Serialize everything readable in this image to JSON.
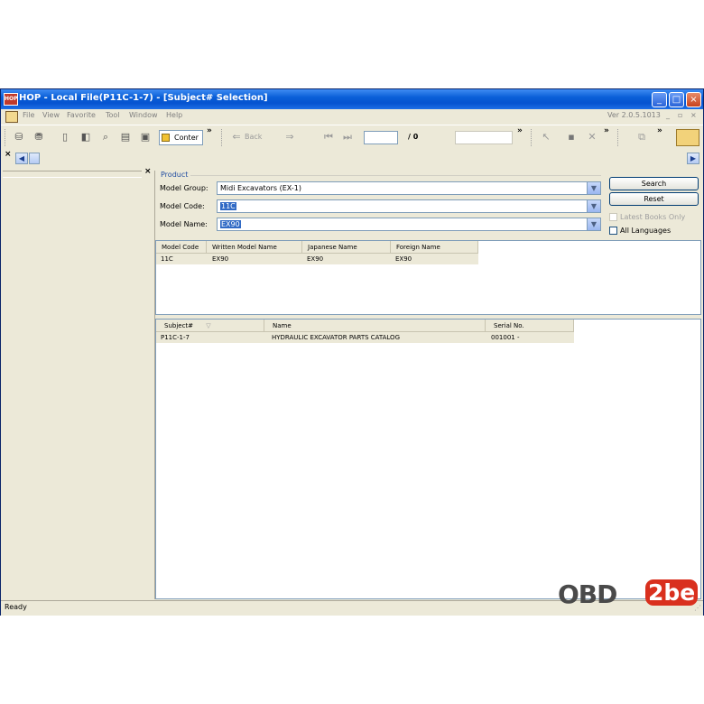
{
  "window": {
    "app_icon": "HOP",
    "title": "HOP - Local File(P11C-1-7) - [Subject# Selection]",
    "minimize": "_",
    "maximize": "□",
    "close": "×"
  },
  "menubar": {
    "items": [
      "File",
      "View",
      "Favorite",
      "Tool",
      "Window",
      "Help"
    ],
    "version": "Ver 2.0.5.1013"
  },
  "toolbar": {
    "contents_label": "Conter",
    "back_label": "Back",
    "page_value": "",
    "page_total": "/ 0",
    "chevron": "»"
  },
  "left_panel": {
    "close": "×"
  },
  "product": {
    "heading": "Product",
    "model_group_label": "Model Group:",
    "model_group_value": "Midi Excavators (EX-1)",
    "model_code_label": "Model Code:",
    "model_code_value": "11C",
    "model_name_label": "Model Name:",
    "model_name_value": "EX90",
    "search_label": "Search",
    "reset_label": "Reset",
    "latest_books_label": "Latest Books Only",
    "all_languages_label": "All Languages"
  },
  "model_table": {
    "headers": [
      "Model Code",
      "Written Model Name",
      "Japanese Name",
      "Foreign Name"
    ],
    "rows": [
      [
        "11C",
        "EX90",
        "EX90",
        "EX90"
      ]
    ]
  },
  "subject_table": {
    "headers": [
      "Subject#",
      "Name",
      "Serial No."
    ],
    "rows": [
      [
        "P11C-1-7",
        "HYDRAULIC EXCAVATOR PARTS CATALOG",
        "001001 -"
      ]
    ]
  },
  "status": {
    "text": "Ready"
  },
  "watermark": {
    "text_left": "OBD",
    "text_right": "2be"
  },
  "colors": {
    "titlebar": "#0a5fd8",
    "selection": "#316ac5",
    "product_heading": "#1f4ba0"
  }
}
